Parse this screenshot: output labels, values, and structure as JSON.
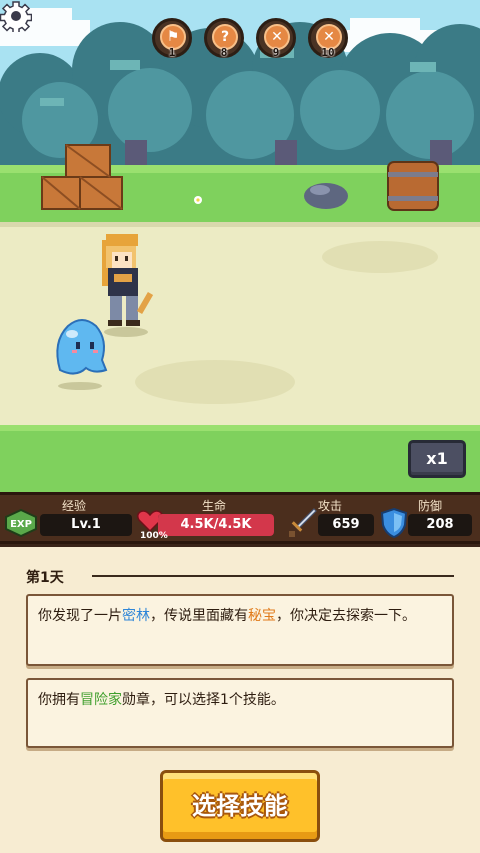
{
  "top_bar": {
    "buttons": [
      {
        "icon": "flag-icon",
        "symbol": "⚑",
        "number": "1"
      },
      {
        "icon": "question-icon",
        "symbol": "?",
        "number": "8"
      },
      {
        "icon": "swords-icon",
        "symbol": "✕",
        "number": "9"
      },
      {
        "icon": "swords-icon",
        "symbol": "✕",
        "number": "10"
      }
    ]
  },
  "speed": {
    "label": "x1"
  },
  "stats": {
    "exp": {
      "label": "经验",
      "value": "Lv.1",
      "icon_text": "EXP"
    },
    "hp": {
      "label": "生命",
      "value": "4.5K/4.5K",
      "percent_text": "100%",
      "fraction": 1.0
    },
    "attack": {
      "label": "攻击",
      "value": "659"
    },
    "defense": {
      "label": "防御",
      "value": "208"
    }
  },
  "story": {
    "day": "第1天",
    "card1": {
      "pre": "你发现了一片",
      "place": "密林",
      "mid": "，传说里面藏有",
      "treasure": "秘宝",
      "post": "，你决定去探索一下。"
    },
    "card2": {
      "pre": "你拥有",
      "badge": "冒险家",
      "post": "勋章，可以选择1个技能。"
    }
  },
  "action_button": {
    "label": "选择技能"
  },
  "colors": {
    "accent_gold": "#ffc12a",
    "hp_red": "#d3374b",
    "highlight_blue": "#2f86d8",
    "highlight_orange": "#e07a1a",
    "highlight_green": "#3f9f2d"
  }
}
